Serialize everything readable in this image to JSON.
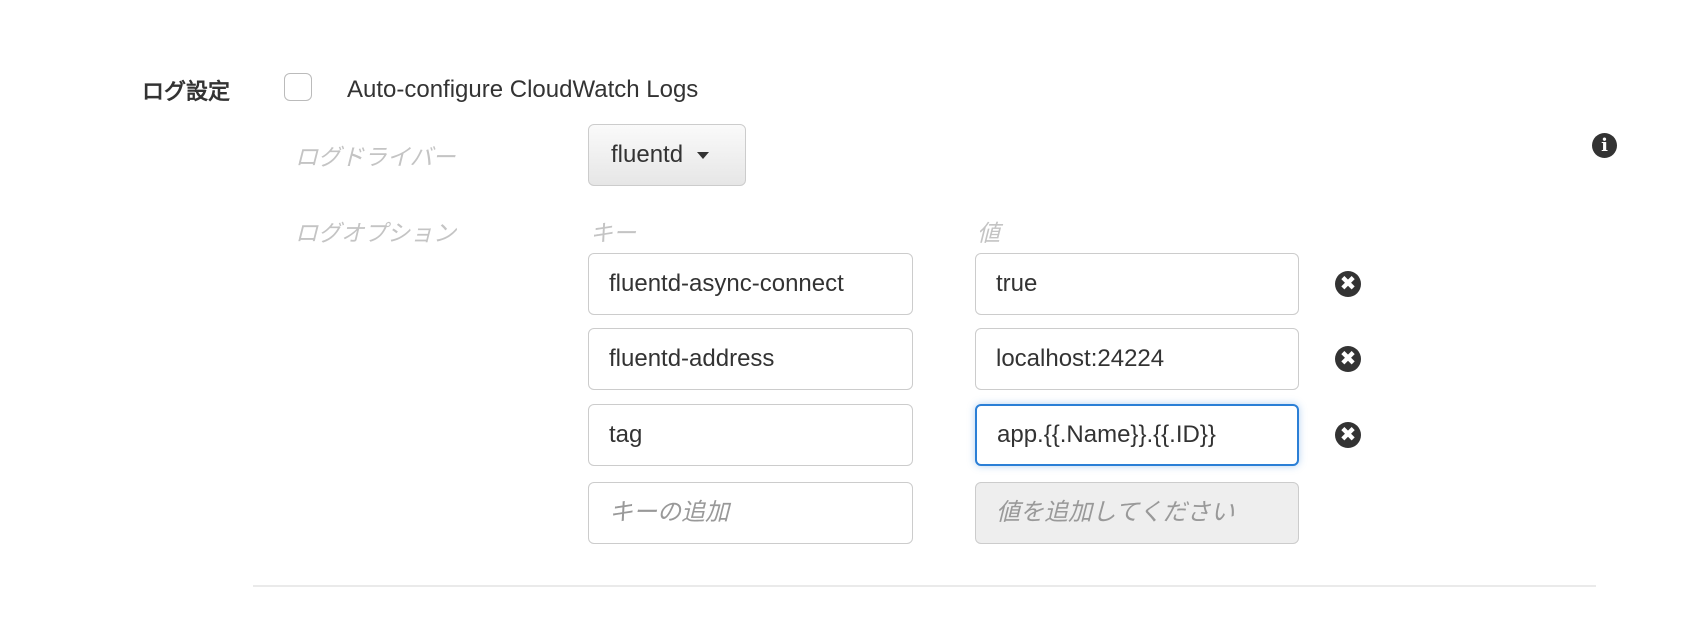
{
  "section": {
    "label": "ログ設定",
    "auto_configure": {
      "label": "Auto-configure CloudWatch Logs",
      "checked": false
    }
  },
  "log_driver": {
    "label": "ログドライバー",
    "value": "fluentd"
  },
  "log_options": {
    "label": "ログオプション",
    "key_header": "キー",
    "value_header": "値",
    "rows": [
      {
        "key": "fluentd-async-connect",
        "value": "true"
      },
      {
        "key": "fluentd-address",
        "value": "localhost:24224"
      },
      {
        "key": "tag",
        "value": "app.{{.Name}}.{{.ID}}"
      }
    ],
    "new_key_placeholder": "キーの追加",
    "new_value_placeholder": "値を追加してください"
  },
  "icons": {
    "info": "i",
    "remove": "✖"
  }
}
